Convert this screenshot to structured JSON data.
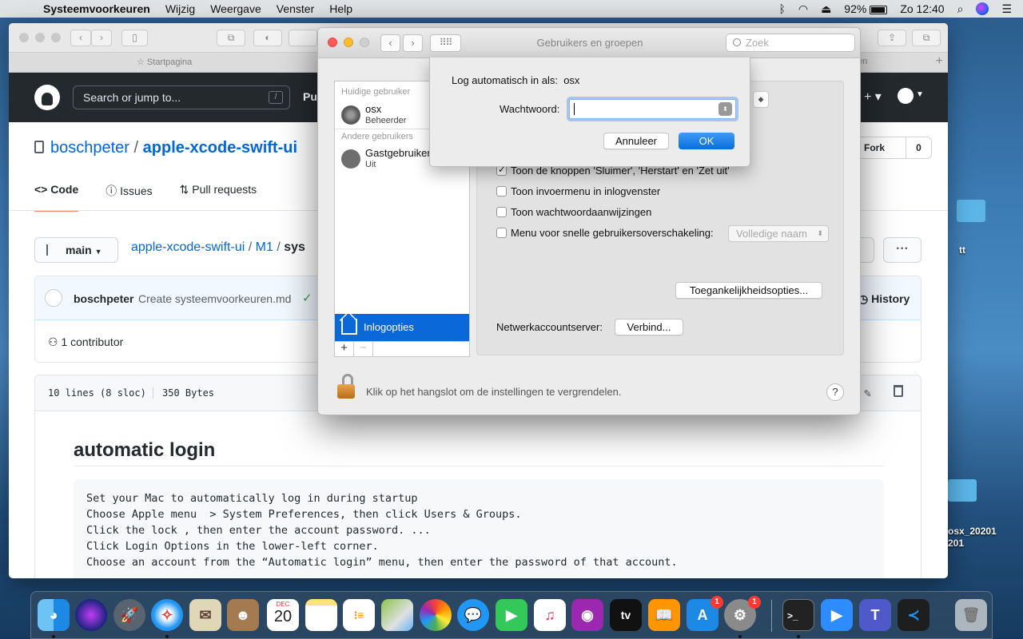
{
  "menubar": {
    "app": "Systeemvoorkeuren",
    "items": [
      "Wijzig",
      "Weergave",
      "Venster",
      "Help"
    ],
    "battery": "92%",
    "clock": "Zo 12:40"
  },
  "desktop": {
    "label_tt": "tt",
    "label_file1": "osx_20201",
    "label_file2": "201"
  },
  "safari": {
    "tab_start": "Startpagina",
    "tab_right": "en",
    "search_placeholder": "Search or jump to...",
    "search_slash": "/",
    "header_pu": "Pu",
    "repo_owner": "boschpeter",
    "repo_sep": "/",
    "repo_name": "apple-xcode-swift-ui",
    "tabs": [
      "Code",
      "Issues",
      "Pull requests"
    ],
    "fork_label": "Fork",
    "fork_count": "0",
    "branch": "main",
    "path_repo": "apple-xcode-swift-ui",
    "path_dir": "M1",
    "path_file": "sys",
    "more": "···",
    "commit_author": "boschpeter",
    "commit_message": "Create systeemvoorkeuren.md",
    "history": "History",
    "contributors": "1 contributor",
    "file_lines": "10 lines (8 sloc)",
    "file_size": "350 Bytes",
    "md_heading": "automatic login",
    "md_code": "Set your Mac to automatically log in during startup\nChoose Apple menu  > System Preferences, then click Users & Groups.\nClick the lock , then enter the account password. ...\nClick Login Options in the lower-left corner.\nChoose an account from the “Automatic login” menu, then enter the password of that account."
  },
  "prefs": {
    "title": "Gebruikers en groepen",
    "search_placeholder": "Zoek",
    "current_users_header": "Huidige gebruiker",
    "user_name": "osx",
    "user_role": "Beheerder",
    "other_users_header": "Andere gebruikers",
    "guest_name": "Gastgebruiker",
    "guest_status": "Uit",
    "login_options": "Inlogopties",
    "options": [
      {
        "label": "Toon de knoppen 'Sluimer', 'Herstart' en 'Zet uit'",
        "checked": true
      },
      {
        "label": "Toon invoermenu in inlogvenster",
        "checked": false
      },
      {
        "label": "Toon wachtwoordaanwijzingen",
        "checked": false
      },
      {
        "label": "Menu voor snelle gebruikersoverschakeling:",
        "checked": false
      }
    ],
    "fast_switch_value": "Volledige naam",
    "accessibility_button": "Toegankelijkheidsopties...",
    "network_label": "Netwerkaccountserver:",
    "connect_button": "Verbind...",
    "lock_text": "Klik op het hangslot om de instellingen te vergrendelen.",
    "help": "?"
  },
  "sheet": {
    "auto_login_label": "Log automatisch in als:",
    "auto_login_user": "osx",
    "password_label": "Wachtwoord:",
    "password_value": "",
    "cancel": "Annuleer",
    "ok": "OK"
  },
  "dock": {
    "apps": [
      "finder-icon",
      "siri-icon",
      "launchpad-icon",
      "safari-icon",
      "mail-icon",
      "contacts-icon",
      "calendar-icon",
      "notes-icon",
      "reminders-icon",
      "maps-icon",
      "photos-icon",
      "messages-icon",
      "facetime-icon",
      "music-icon",
      "podcasts-icon",
      "appletv-icon",
      "books-icon",
      "appstore-icon",
      "systemprefs-icon",
      "terminal-icon",
      "zoom-icon",
      "teams-icon",
      "vscode-icon",
      "trash-icon"
    ],
    "calendar_month": "DEC",
    "calendar_day": "20",
    "appstore_badge": "1",
    "prefs_badge": "1",
    "tv_label": "tv"
  }
}
